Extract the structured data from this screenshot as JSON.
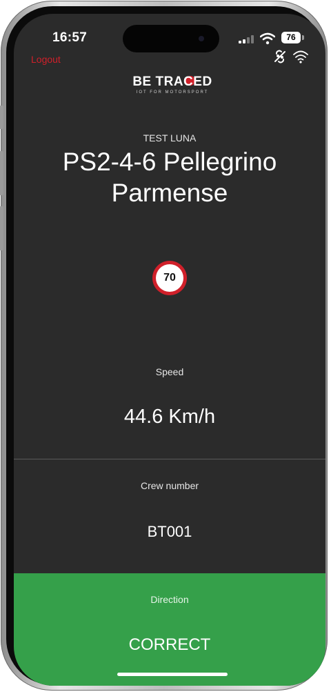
{
  "status_bar": {
    "time": "16:57",
    "battery": "76",
    "icons": [
      "cellular-signal-icon",
      "wifi-status-icon",
      "battery-icon"
    ]
  },
  "header": {
    "logout_label": "Logout",
    "logo_text": "BE TRACED",
    "logo_tagline": "IOT FOR MOTORSPORT",
    "icons": [
      "gps-off-icon",
      "wifi-icon"
    ]
  },
  "stage": {
    "session": "TEST LUNA",
    "title": "PS2-4-6 Pellegrino Parmense"
  },
  "speed_limit": "70",
  "speed": {
    "label": "Speed",
    "value": "44.6 Km/h"
  },
  "crew": {
    "label": "Crew number",
    "value": "BT001"
  },
  "direction": {
    "label": "Direction",
    "value": "CORRECT"
  },
  "colors": {
    "background": "#2b2b2b",
    "accent_red": "#d0202a",
    "direction_ok_green": "#35a04a"
  }
}
